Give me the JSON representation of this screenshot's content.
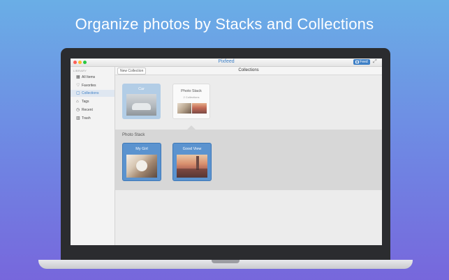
{
  "headline": "Organize photos by Stacks and Collections",
  "window": {
    "app_title": "Pixfeed",
    "feed_button": "Feed"
  },
  "sidebar": {
    "section": "LIBRARY",
    "items": [
      {
        "label": "All Items",
        "icon": "grid-icon"
      },
      {
        "label": "Favorites",
        "icon": "heart-icon"
      },
      {
        "label": "Collections",
        "icon": "collection-icon",
        "active": true
      },
      {
        "label": "Tags",
        "icon": "tag-icon"
      },
      {
        "label": "Recent",
        "icon": "clock-icon"
      },
      {
        "label": "Trash",
        "icon": "trash-icon"
      }
    ]
  },
  "toolbar": {
    "new_collection": "New Collection",
    "title": "Collections"
  },
  "collections": [
    {
      "title": "Car"
    },
    {
      "title": "Photo Stack",
      "subtitle": "2 Collections"
    }
  ],
  "stack": {
    "title": "Photo Stack",
    "items": [
      {
        "title": "My Girl"
      },
      {
        "title": "Good View"
      }
    ]
  },
  "colors": {
    "accent": "#3d7fc6",
    "selected_card": "#5b93cf"
  }
}
